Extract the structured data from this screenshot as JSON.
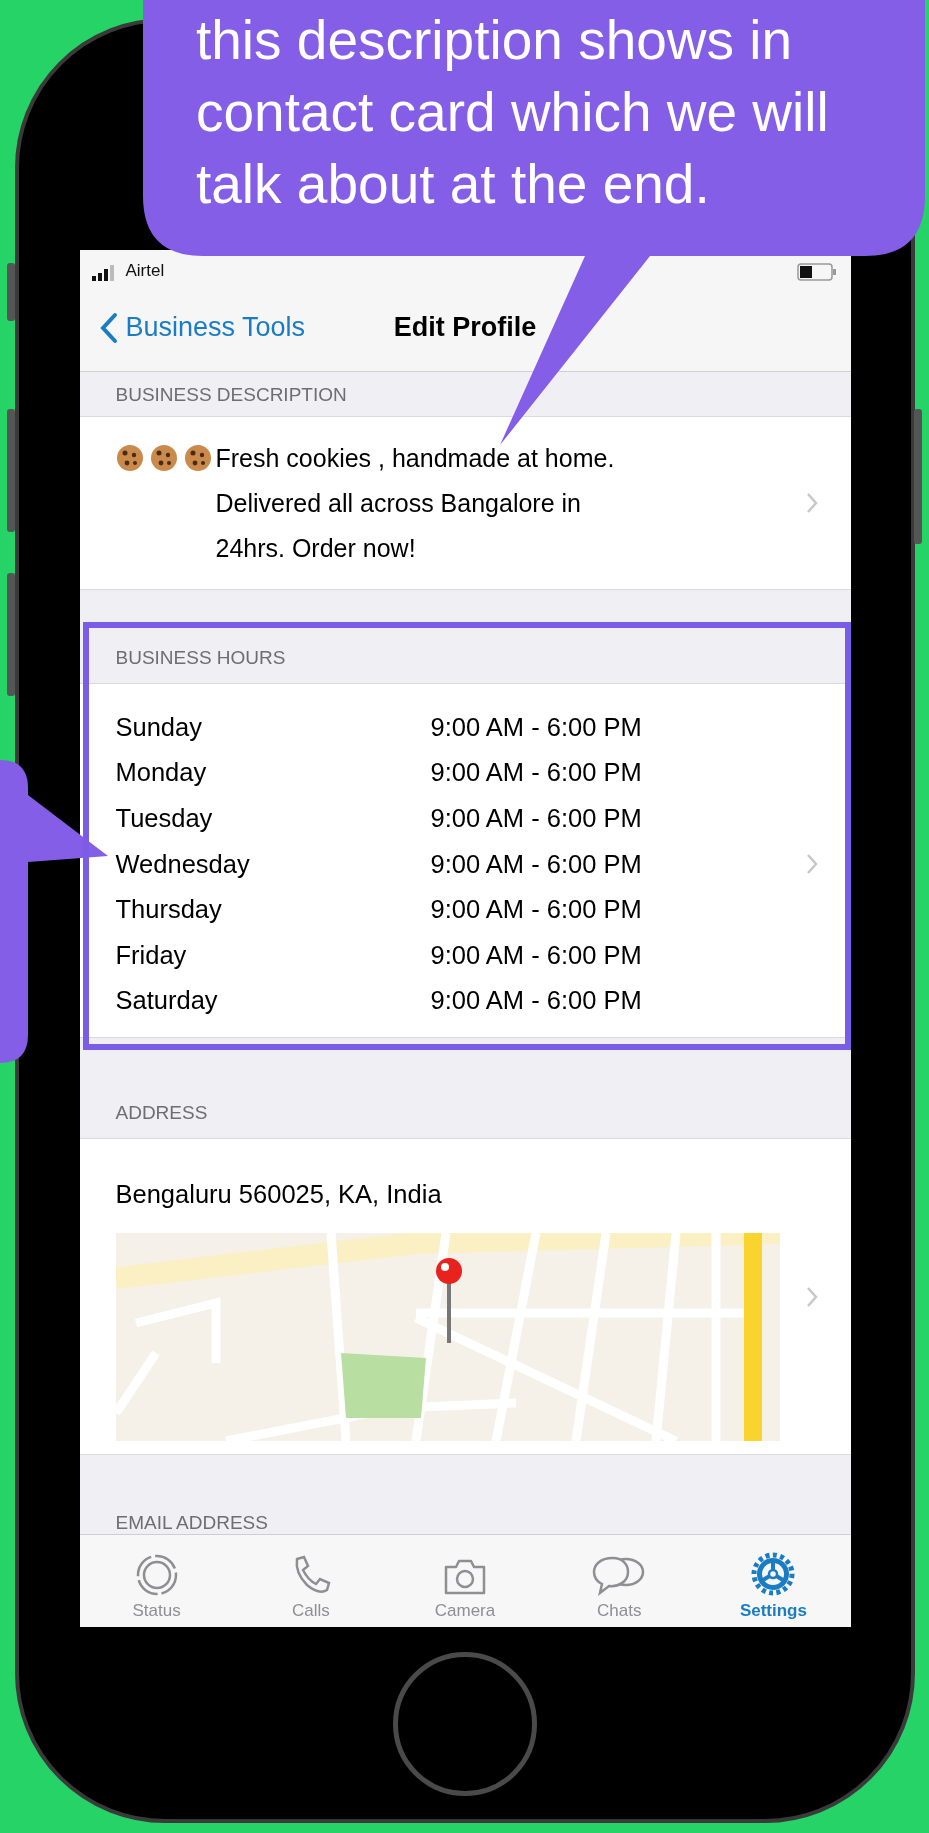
{
  "callout": {
    "text": "this description shows in contact card which we will talk about at the end."
  },
  "status_bar": {
    "carrier": "Airtel"
  },
  "nav": {
    "back": "Business Tools",
    "title": "Edit Profile"
  },
  "description": {
    "header": "BUSINESS DESCRIPTION",
    "text": "Fresh cookies , handmade at home. Delivered all across Bangalore in 24hrs. Order now!"
  },
  "hours": {
    "header": "BUSINESS HOURS",
    "highlighted": true,
    "rows": [
      {
        "day": "Sunday",
        "time": "9:00 AM - 6:00 PM"
      },
      {
        "day": "Monday",
        "time": "9:00 AM - 6:00 PM"
      },
      {
        "day": "Tuesday",
        "time": "9:00 AM - 6:00 PM"
      },
      {
        "day": "Wednesday",
        "time": "9:00 AM - 6:00 PM"
      },
      {
        "day": "Thursday",
        "time": "9:00 AM - 6:00 PM"
      },
      {
        "day": "Friday",
        "time": "9:00 AM - 6:00 PM"
      },
      {
        "day": "Saturday",
        "time": "9:00 AM - 6:00 PM"
      }
    ]
  },
  "address": {
    "header": "ADDRESS",
    "text": "Bengaluru 560025, KA, India"
  },
  "email": {
    "header": "EMAIL ADDRESS"
  },
  "tabs": [
    {
      "label": "Status",
      "selected": false
    },
    {
      "label": "Calls",
      "selected": false
    },
    {
      "label": "Camera",
      "selected": false
    },
    {
      "label": "Chats",
      "selected": false
    },
    {
      "label": "Settings",
      "selected": true
    }
  ]
}
